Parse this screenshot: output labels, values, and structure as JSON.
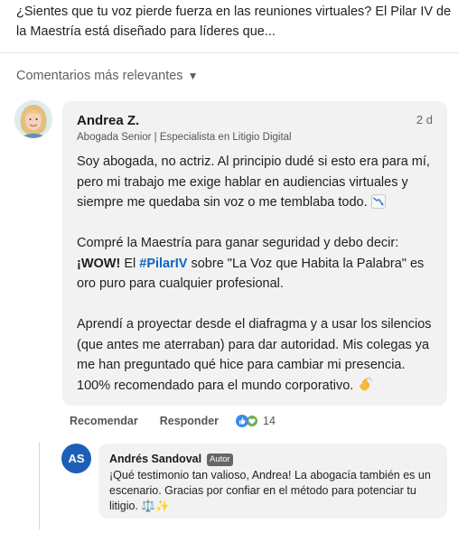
{
  "post": {
    "text": "¿Sientes que tu voz pierde fuerza en las reuniones virtuales? El Pilar IV de la Maestría está diseñado para líderes que..."
  },
  "comments_header": {
    "sort_label": "Comentarios más relevantes",
    "sort_icon": "triangle-down-icon"
  },
  "comment": {
    "author": "Andrea Z.",
    "time": "2 d",
    "headline": "Abogada Senior | Especialista en Litigio Digital",
    "p1": "Soy abogada, no actriz. Al principio dudé si esto era para mí, pero mi trabajo me exige hablar en audiencias virtuales y siempre me quedaba sin voz o me temblaba todo.",
    "p2_before_wow": "Compré la Maestría para ganar seguridad y debo decir: ",
    "p2_wow": "¡WOW!",
    "p2_mid": " El ",
    "p2_hashtag": "#PilarIV",
    "p2_after": " sobre \"La Voz que Habita la Palabra\" es oro puro para cualquier profesional.",
    "p3": "Aprendí a proyectar desde el diafragma y a usar los silencios (que antes me aterraban) para dar autoridad. Mis colegas ya me han preguntado qué hice para cambiar mi presencia. 100% recomendado para el mundo corporativo.",
    "emoji_1": "chart-decreasing-icon",
    "emoji_2": "clapping-hands-icon"
  },
  "comment_actions": {
    "recommend": "Recomendar",
    "reply": "Responder",
    "reaction_icons": [
      "like-icon",
      "support-icon"
    ],
    "reaction_count": "14"
  },
  "reply": {
    "avatar_initials": "AS",
    "author": "Andrés Sandoval",
    "badge": "Autor",
    "text": "¡Qué testimonio tan valioso, Andrea! La abogacía también es un escenario. Gracias por confiar en el método para potenciar tu litigio. ⚖️✨"
  },
  "colors": {
    "hashtag": "#0a66c2",
    "bubble_bg": "#f2f2f2",
    "reply_avatar": "#1d5fb8",
    "like": "#378fe9",
    "support": "#6dae4f"
  }
}
